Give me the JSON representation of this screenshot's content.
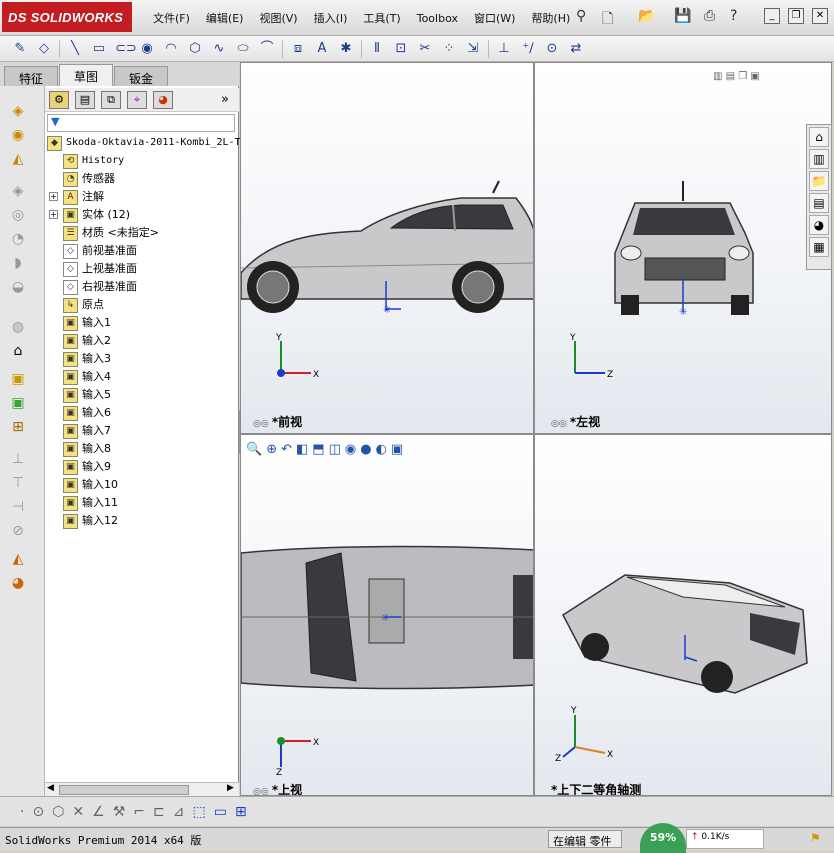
{
  "app": {
    "logo": "SOLIDWORKS",
    "logo_prefix": "DS"
  },
  "menu": [
    "文件(F)",
    "编辑(E)",
    "视图(V)",
    "插入(I)",
    "工具(T)",
    "Toolbox",
    "窗口(W)",
    "帮助(H)"
  ],
  "tabs": [
    "特征",
    "草图",
    "钣金"
  ],
  "active_tab": "草图",
  "tree": {
    "root": "Skoda-Oktavia-2011-Kombi_2L-T",
    "items": [
      {
        "label": "History",
        "icon": "history-icon",
        "expand": false
      },
      {
        "label": "传感器",
        "icon": "sensor-icon",
        "expand": false
      },
      {
        "label": "注解",
        "icon": "annotation-icon",
        "expand": true
      },
      {
        "label": "实体 (12)",
        "icon": "solid-bodies-icon",
        "expand": true
      },
      {
        "label": "材质 <未指定>",
        "icon": "material-icon",
        "expand": false
      },
      {
        "label": "前视基准面",
        "icon": "plane-icon",
        "expand": false
      },
      {
        "label": "上视基准面",
        "icon": "plane-icon",
        "expand": false
      },
      {
        "label": "右视基准面",
        "icon": "plane-icon",
        "expand": false
      },
      {
        "label": "原点",
        "icon": "origin-icon",
        "expand": false
      },
      {
        "label": "输入1",
        "icon": "import-icon",
        "expand": false
      },
      {
        "label": "输入2",
        "icon": "import-icon",
        "expand": false
      },
      {
        "label": "输入3",
        "icon": "import-icon",
        "expand": false
      },
      {
        "label": "输入4",
        "icon": "import-icon",
        "expand": false
      },
      {
        "label": "输入5",
        "icon": "import-icon",
        "expand": false
      },
      {
        "label": "输入6",
        "icon": "import-icon",
        "expand": false
      },
      {
        "label": "输入7",
        "icon": "import-icon",
        "expand": false
      },
      {
        "label": "输入8",
        "icon": "import-icon",
        "expand": false
      },
      {
        "label": "输入9",
        "icon": "import-icon",
        "expand": false
      },
      {
        "label": "输入10",
        "icon": "import-icon",
        "expand": false
      },
      {
        "label": "输入11",
        "icon": "import-icon",
        "expand": false
      },
      {
        "label": "输入12",
        "icon": "import-icon",
        "expand": false
      }
    ]
  },
  "viewports": {
    "front": "*前视",
    "left": "*左视",
    "top": "*上视",
    "iso": "*上下二等角轴测"
  },
  "axes": {
    "x": "X",
    "y": "Y",
    "z": "Z"
  },
  "status": {
    "version": "SolidWorks Premium 2014 x64 版",
    "mode": "在编辑 零件",
    "cpu": "59%",
    "net": "0.1K/s"
  },
  "colors": {
    "logo_red": "#c31d22",
    "axis_x": "#d02020",
    "axis_y": "#1a8c2a",
    "axis_z": "#1a3ccc"
  }
}
